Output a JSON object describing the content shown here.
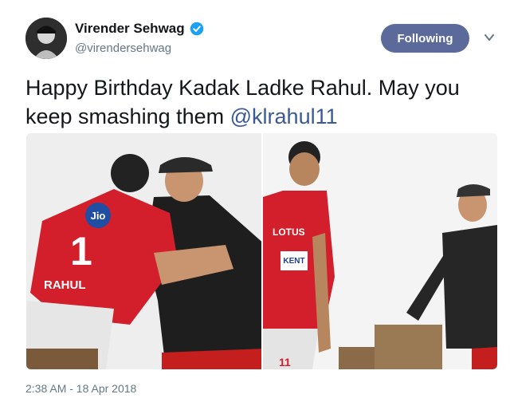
{
  "author": {
    "name": "Virender Sehwag",
    "handle": "@virendersehwag",
    "verified": true,
    "verified_color": "#1da1f2"
  },
  "follow_button": {
    "label": "Following",
    "color": "#5b6a9a"
  },
  "tweet": {
    "text_plain": "Happy Birthday Kadak Ladke Rahul. May you keep smashing them ",
    "mention": "@klrahul11",
    "mention_color": "#3b5998",
    "timestamp": "2:38 AM - 18 Apr 2018"
  },
  "media": {
    "photos": [
      {
        "description_icon": "photo-hug"
      },
      {
        "description_icon": "photo-standing"
      }
    ],
    "jersey_text_left": {
      "sponsor": "Jio",
      "number": "1",
      "name": "RAHUL"
    },
    "jersey_text_right": {
      "sponsor": "LOTUS",
      "sponsor2": "KENT",
      "number": "11"
    }
  },
  "icons": {
    "verified": "verified-badge-icon",
    "caret": "chevron-down-icon"
  }
}
